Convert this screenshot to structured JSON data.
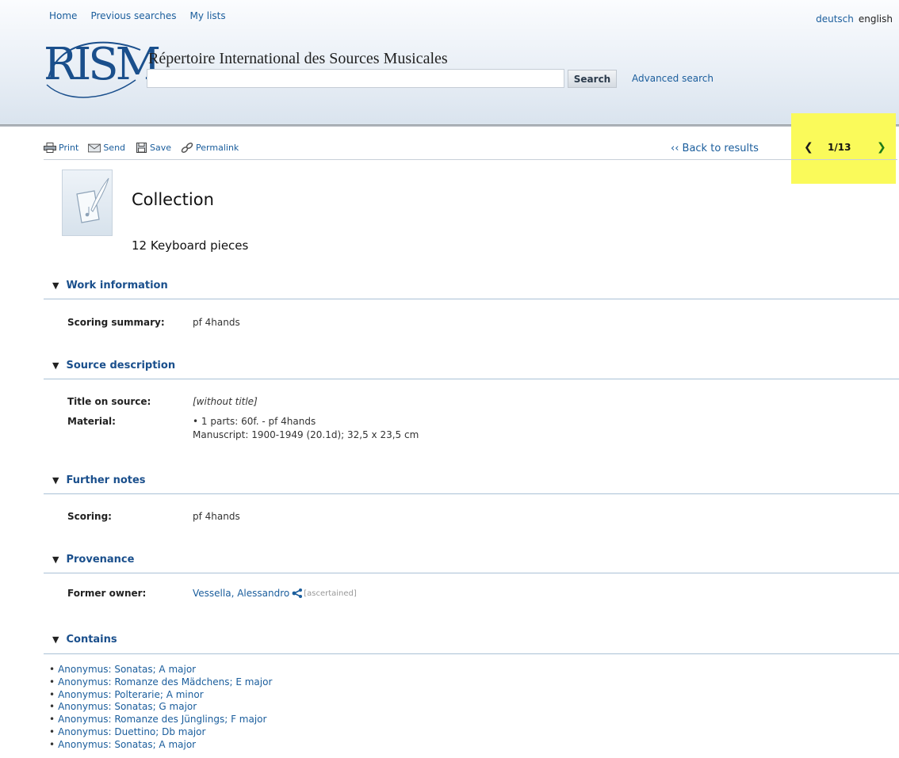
{
  "nav": {
    "home": "Home",
    "previous_searches": "Previous searches",
    "my_lists": "My lists",
    "lang_de": "deutsch",
    "lang_en": "english"
  },
  "brand": {
    "logo_text": "RISM",
    "site_title": "Répertoire International des Sources Musicales"
  },
  "search": {
    "value": "",
    "placeholder": "",
    "button": "Search",
    "advanced": "Advanced search"
  },
  "toolbar": {
    "print": "Print",
    "send": "Send",
    "save": "Save",
    "permalink": "Permalink",
    "back": "‹‹ Back to results"
  },
  "pager": {
    "prev": "❮",
    "count": "1/13",
    "next": "❯"
  },
  "record": {
    "type": "Collection",
    "title": "12 Keyboard pieces"
  },
  "sections": {
    "work": {
      "heading": "Work information",
      "scoring_summary_label": "Scoring summary:",
      "scoring_summary_value": "pf 4hands"
    },
    "source": {
      "heading": "Source description",
      "title_label": "Title on source:",
      "title_value": "[without title]",
      "material_label": "Material:",
      "material_line1": "1 parts: 60f. - pf 4hands",
      "material_line2": "Manuscript: 1900-1949 (20.1d); 32,5 x 23,5 cm"
    },
    "notes": {
      "heading": "Further notes",
      "scoring_label": "Scoring:",
      "scoring_value": "pf 4hands"
    },
    "provenance": {
      "heading": "Provenance",
      "owner_label": "Former owner:",
      "owner_value": "Vessella, Alessandro",
      "owner_note": "[ascertained]"
    },
    "contains": {
      "heading": "Contains",
      "items": [
        "Anonymus: Sonatas; A major",
        "Anonymus: Romanze des Mädchens; E major",
        "Anonymus: Polterarie; A minor",
        "Anonymus: Sonatas; G major",
        "Anonymus: Romanze des Jünglings; F major",
        "Anonymus: Duettino; Db major",
        "Anonymus: Sonatas; A major"
      ]
    }
  },
  "colors": {
    "link": "#1a5d9c",
    "heading": "#1a4f8c",
    "highlight": "#fafa5a",
    "next_arrow": "#1e7a18"
  }
}
